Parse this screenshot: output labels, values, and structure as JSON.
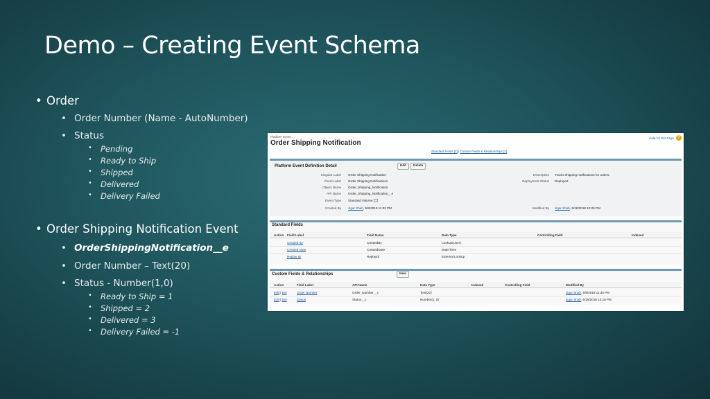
{
  "slide": {
    "title": "Demo – Creating Event Schema",
    "bullets": {
      "order": {
        "label": "Order",
        "order_number": "Order Number (Name - AutoNumber)",
        "status": "Status",
        "status_values": [
          "Pending",
          "Ready to Ship",
          "Shipped",
          "Delivered",
          "Delivery Failed"
        ]
      },
      "event": {
        "label": "Order Shipping Notification Event",
        "api_name": "OrderShippingNotification__e",
        "order_number": "Order Number – Text(20)",
        "status": "Status - Number(1,0)",
        "status_values": [
          "Ready to Ship = 1",
          "Shipped = 2",
          "Delivered = 3",
          "Delivery Failed = -1"
        ]
      }
    },
    "bullet_char": "•"
  },
  "sf": {
    "object_type": "Platform Event",
    "object_name": "Order Shipping Notification",
    "help_link": "Help for this Page",
    "help_icon": "?",
    "crumbs": {
      "standard": "Standard Fields [3]",
      "sep": "|",
      "custom": "Custom Fields & Relationships [2]"
    },
    "detail": {
      "title": "Platform Event Definition Detail",
      "edit": "Edit",
      "delete": "Delete",
      "left_fields": [
        {
          "label": "Singular Label",
          "value": "Order Shipping Notification"
        },
        {
          "label": "Plural Label",
          "value": "Order Shipping Notifications"
        },
        {
          "label": "Object Name",
          "value": "Order_Shipping_Notification"
        },
        {
          "label": "API Name",
          "value": "Order_Shipping_Notification__e"
        },
        {
          "label": "Event Type",
          "value": "Standard Volume"
        },
        {
          "label": "Created By",
          "value_link": "Jigar Shah",
          "value": ", 5/8/2018 11:33 PM"
        }
      ],
      "right_fields": [
        {
          "label": "Description",
          "value": "Tracks shipping notifications for orders."
        },
        {
          "label": "Deployment Status",
          "value": "Deployed"
        },
        {
          "label": "Modified By",
          "value_link": "Jigar Shah",
          "value": ", 5/18/2018 10:26 PM"
        }
      ]
    },
    "standard_fields": {
      "title": "Standard Fields",
      "columns": [
        "Action",
        "Field Label",
        "Field Name",
        "Data Type",
        "Controlling Field",
        "Indexed"
      ],
      "rows": [
        {
          "label": "Created By",
          "name": "CreatedBy",
          "type": "Lookup(User)"
        },
        {
          "label": "Created Date",
          "name": "CreatedDate",
          "type": "Date/Time"
        },
        {
          "label": "Replay ID",
          "name": "ReplayId",
          "type": "External Lookup"
        }
      ]
    },
    "custom_fields": {
      "title": "Custom Fields & Relationships",
      "new": "New",
      "columns": [
        "Action",
        "Field Label",
        "API Name",
        "Data Type",
        "Indexed",
        "Controlling Field",
        "Modified By"
      ],
      "rows": [
        {
          "edit": "Edit",
          "del": "Del",
          "label": "Order Number",
          "api": "Order_Number__c",
          "type": "Text(20)",
          "mod_link": "Jigar Shah",
          "mod": ", 5/8/2018 11:33 PM"
        },
        {
          "edit": "Edit",
          "del": "Del",
          "label": "Status",
          "api": "Status__c",
          "type": "Number(1, 0)",
          "mod_link": "Jigar Shah",
          "mod": ", 5/18/2018 10:19 PM"
        }
      ]
    }
  }
}
